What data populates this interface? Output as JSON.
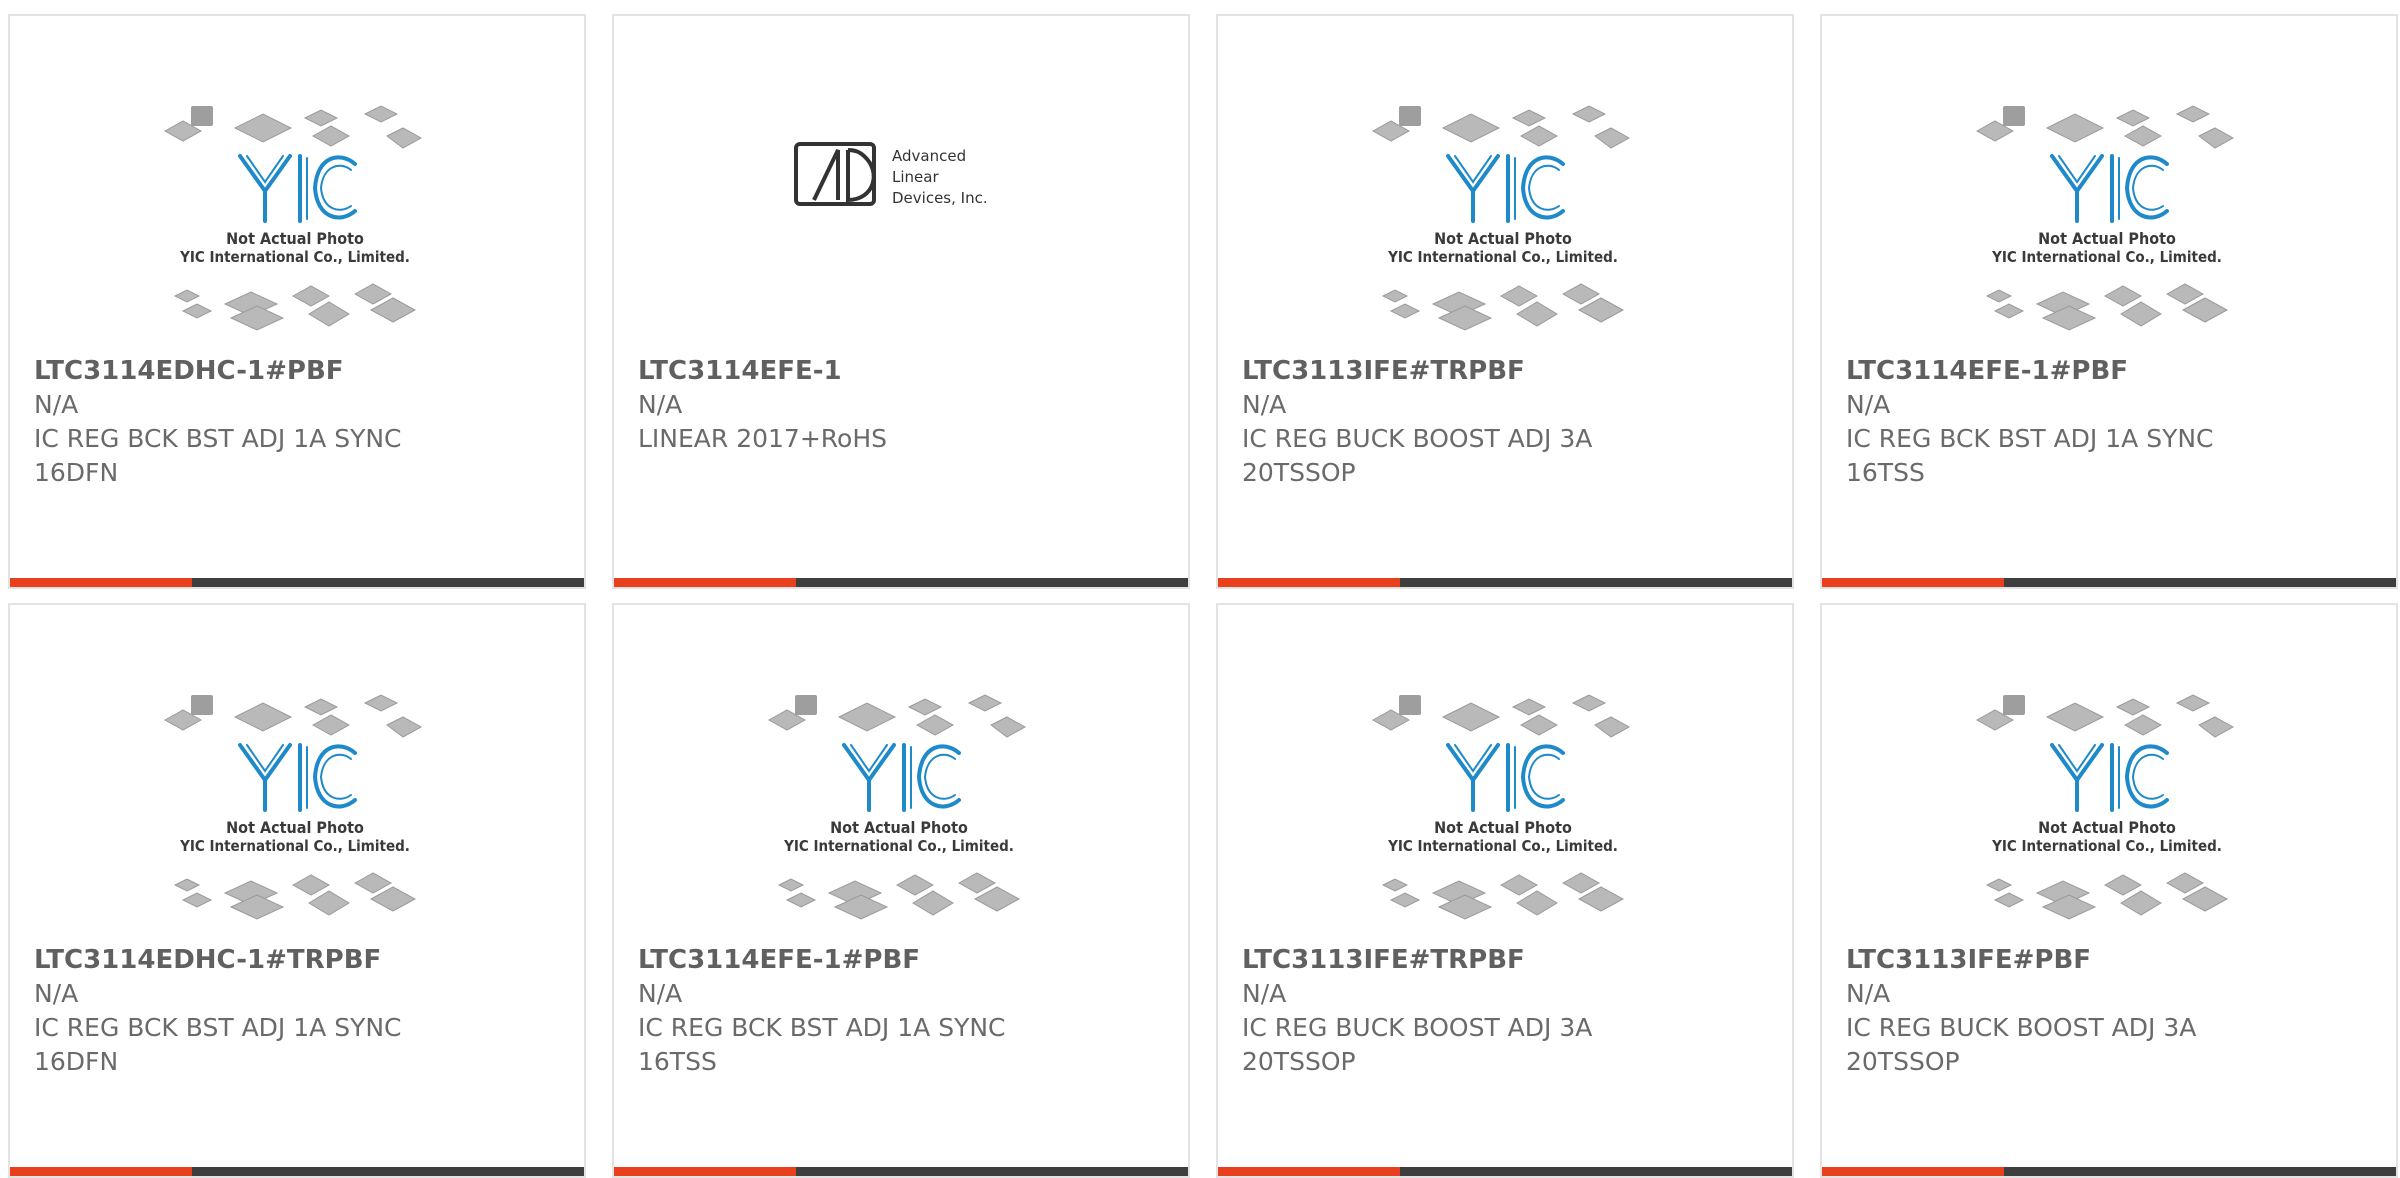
{
  "colors": {
    "accent": "#e8401c",
    "bar": "#3e3e3e",
    "text": "#6a6a6a",
    "logo_blue": "#1f8ac9"
  },
  "placeholder": {
    "icon": "yic-placeholder-image",
    "line1": "Not Actual Photo",
    "line2": "YIC International Co., Limited.",
    "logo": "YIC"
  },
  "brand_logo": {
    "icon": "ald-logo",
    "line1": "Advanced",
    "line2": "Linear",
    "line3": "Devices, Inc."
  },
  "products": [
    {
      "part": "LTC3114EDHC-1#PBF",
      "status": "N/A",
      "desc": "IC REG BCK BST ADJ 1A SYNC 16DFN",
      "image": "placeholder"
    },
    {
      "part": "LTC3114EFE-1",
      "status": "N/A",
      "desc": "LINEAR 2017+RoHS",
      "image": "brand"
    },
    {
      "part": "LTC3113IFE#TRPBF",
      "status": "N/A",
      "desc": "IC REG BUCK BOOST ADJ 3A 20TSSOP",
      "image": "placeholder"
    },
    {
      "part": "LTC3114EFE-1#PBF",
      "status": "N/A",
      "desc": "IC REG BCK BST ADJ 1A SYNC 16TSS",
      "image": "placeholder"
    },
    {
      "part": "LTC3114EDHC-1#TRPBF",
      "status": "N/A",
      "desc": "IC REG BCK BST ADJ 1A SYNC 16DFN",
      "image": "placeholder"
    },
    {
      "part": "LTC3114EFE-1#PBF",
      "status": "N/A",
      "desc": "IC REG BCK BST ADJ 1A SYNC 16TSS",
      "image": "placeholder"
    },
    {
      "part": "LTC3113IFE#TRPBF",
      "status": "N/A",
      "desc": "IC REG BUCK BOOST ADJ 3A 20TSSOP",
      "image": "placeholder"
    },
    {
      "part": "LTC3113IFE#PBF",
      "status": "N/A",
      "desc": "IC REG BUCK BOOST ADJ 3A 20TSSOP",
      "image": "placeholder"
    }
  ]
}
